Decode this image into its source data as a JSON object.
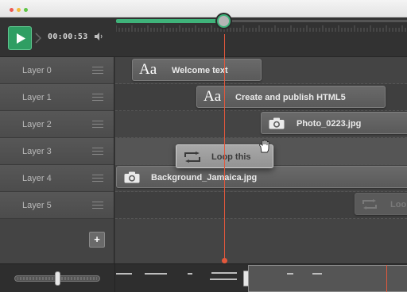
{
  "transport": {
    "timecode": "00:00:53",
    "progress_fraction": 0.37
  },
  "layers": [
    {
      "label": "Layer 0"
    },
    {
      "label": "Layer 1"
    },
    {
      "label": "Layer 2"
    },
    {
      "label": "Layer 3"
    },
    {
      "label": "Layer 4"
    },
    {
      "label": "Layer 5"
    }
  ],
  "clips": {
    "welcome": {
      "text": "Welcome text",
      "glyph": "Aa"
    },
    "create": {
      "text": "Create and publish HTML5",
      "glyph": "Aa"
    },
    "photo": {
      "text": "Photo_0223.jpg"
    },
    "loop": {
      "text": "Loop this"
    },
    "background": {
      "text": "Background_Jamaica.jpg"
    },
    "loop_ghost": {
      "text": "Loo"
    }
  },
  "colors": {
    "accent_green": "#3fb37a",
    "playhead": "#e3583c"
  },
  "icons": {
    "play": "play-icon",
    "volume": "speaker-icon",
    "camera": "camera-icon",
    "loop": "loop-icon",
    "hand": "grab-hand-icon",
    "add": "plus-icon"
  }
}
